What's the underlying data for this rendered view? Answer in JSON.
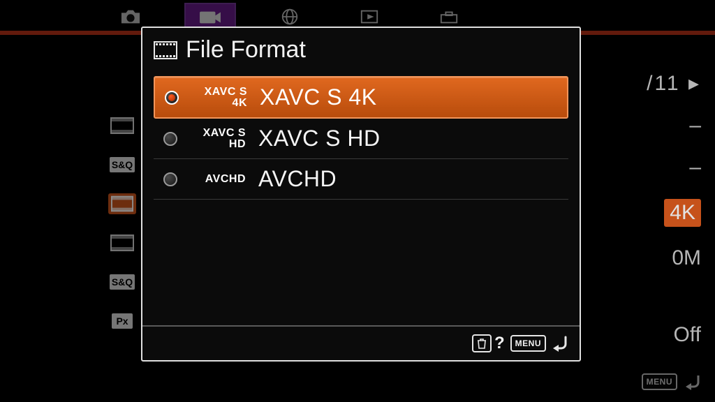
{
  "page_indicator": "/11",
  "menu_badge": "MENU",
  "dialog": {
    "title": "File Format",
    "options": [
      {
        "short_l1": "XAVC S",
        "short_l2": "4K",
        "label": "XAVC S 4K",
        "selected": true
      },
      {
        "short_l1": "XAVC S",
        "short_l2": "HD",
        "label": "XAVC S HD",
        "selected": false
      },
      {
        "short_l1": "AVCHD",
        "short_l2": "",
        "label": "AVCHD",
        "selected": false
      }
    ]
  },
  "background_values": {
    "page": "/11 ▸",
    "dash1": "–",
    "dash2": "–",
    "v_4k": "4K",
    "v_rate": "0M",
    "v_off": "Off"
  },
  "footer": {
    "help": "?",
    "menu": "MENU"
  }
}
